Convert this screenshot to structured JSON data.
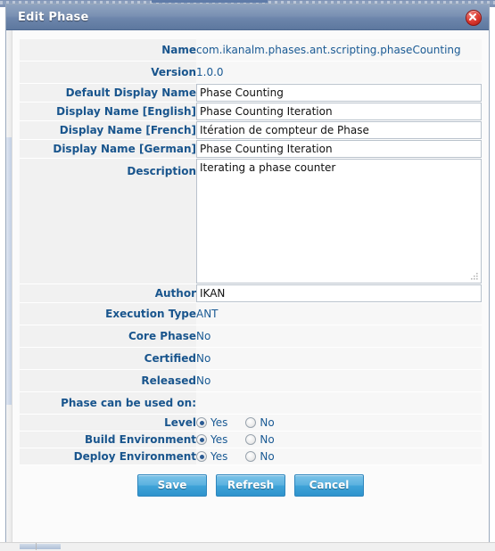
{
  "window": {
    "title": "Edit Phase",
    "close_icon": "close-icon",
    "accent_color": "#19558d",
    "titlebar_color": "#6d85ab",
    "button_color": "#3fa3d8",
    "close_button_color": "#d9352c"
  },
  "form": {
    "rows": [
      {
        "label": "Name",
        "type": "readonly",
        "value": "com.ikanalm.phases.ant.scripting.phaseCounting"
      },
      {
        "label": "Version",
        "type": "readonly",
        "value": "1.0.0"
      },
      {
        "label": "Default Display Name",
        "type": "input",
        "value": "Phase Counting"
      },
      {
        "label": "Display Name [English]",
        "type": "input",
        "value": "Phase Counting Iteration"
      },
      {
        "label": "Display Name [French]",
        "type": "input",
        "value": "Itération de compteur de Phase"
      },
      {
        "label": "Display Name [German]",
        "type": "input",
        "value": "Phase Counting Iteration"
      },
      {
        "label": "Description",
        "type": "textarea",
        "value": "Iterating a phase counter"
      },
      {
        "label": "Author",
        "type": "input",
        "value": "IKAN"
      },
      {
        "label": "Execution Type",
        "type": "readonly",
        "value": "ANT"
      },
      {
        "label": "Core Phase",
        "type": "readonly",
        "value": "No"
      },
      {
        "label": "Certified",
        "type": "readonly",
        "value": "No"
      },
      {
        "label": "Released",
        "type": "readonly",
        "value": "No"
      },
      {
        "label": "Phase can be used on:",
        "type": "section",
        "value": ""
      },
      {
        "label": "Level",
        "type": "radio",
        "value": "Yes"
      },
      {
        "label": "Build Environment",
        "type": "radio",
        "value": "Yes"
      },
      {
        "label": "Deploy Environment",
        "type": "radio",
        "value": "Yes"
      }
    ],
    "radio_options": [
      "Yes",
      "No"
    ]
  },
  "footer": {
    "save_label": "Save",
    "refresh_label": "Refresh",
    "cancel_label": "Cancel"
  }
}
